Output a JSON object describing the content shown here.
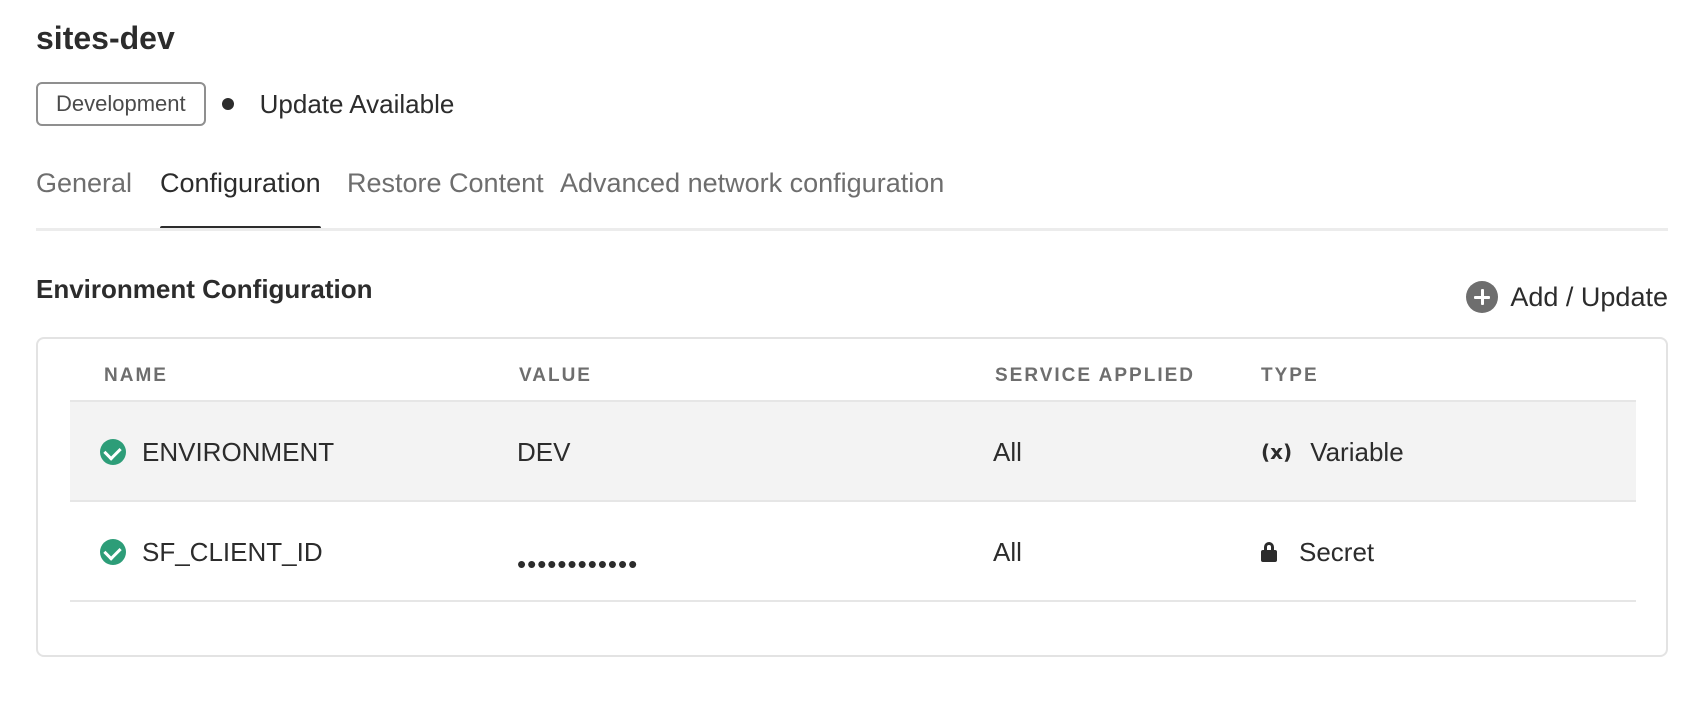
{
  "environment": {
    "name": "sites-dev",
    "badge": "Development",
    "status": "Update Available"
  },
  "tabs": [
    {
      "label": "General",
      "active": false
    },
    {
      "label": "Configuration",
      "active": true
    },
    {
      "label": "Restore Content",
      "active": false
    },
    {
      "label": "Advanced network configuration",
      "active": false
    }
  ],
  "section": {
    "title": "Environment Configuration",
    "add_label": "Add / Update"
  },
  "table": {
    "columns": [
      "NAME",
      "VALUE",
      "SERVICE APPLIED",
      "TYPE"
    ],
    "rows": [
      {
        "name": "ENVIRONMENT",
        "value": "DEV",
        "service": "All",
        "type": "Variable",
        "type_icon": "variable-icon",
        "status_icon": "check-circle-icon"
      },
      {
        "name": "SF_CLIENT_ID",
        "value": "••••••••••••",
        "service": "All",
        "type": "Secret",
        "type_icon": "lock-icon",
        "status_icon": "check-circle-icon"
      }
    ]
  },
  "colors": {
    "accent_text": "#2c2c2c",
    "success": "#2d9d78",
    "row_highlight": "#f3f3f3"
  }
}
